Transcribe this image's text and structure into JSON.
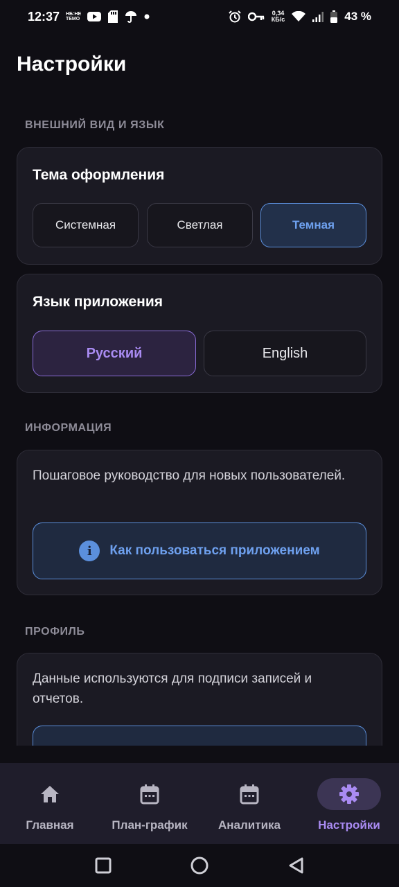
{
  "status_bar": {
    "time": "12:37",
    "mini_icon_text": "НБ:НЕ ТЕМО",
    "net_speed_value": "0,34",
    "net_speed_unit": "КБ/с",
    "battery": "43 %"
  },
  "page": {
    "title": "Настройки"
  },
  "appearance": {
    "section_label": "ВНЕШНИЙ ВИД И ЯЗЫК",
    "theme": {
      "title": "Тема оформления",
      "options": [
        "Системная",
        "Светлая",
        "Темная"
      ],
      "selected": "Темная"
    },
    "language": {
      "title": "Язык приложения",
      "options": [
        "Русский",
        "English"
      ],
      "selected": "Русский"
    }
  },
  "info": {
    "section_label": "ИНФОРМАЦИЯ",
    "description": "Пошаговое руководство для новых пользователей.",
    "help_button": "Как пользоваться приложением"
  },
  "profile": {
    "section_label": "ПРОФИЛЬ",
    "description": "Данные используются для подписи записей и отчетов."
  },
  "bottom_nav": {
    "items": [
      {
        "label": "Главная",
        "icon": "home-icon"
      },
      {
        "label": "План-график",
        "icon": "calendar-icon"
      },
      {
        "label": "Аналитика",
        "icon": "calendar-icon"
      },
      {
        "label": "Настройки",
        "icon": "gear-icon"
      }
    ],
    "active": "Настройки"
  },
  "colors": {
    "background": "#0f0e14",
    "card": "#1b1a23",
    "accent_blue": "#6ea0ee",
    "accent_purple": "#a98bf2"
  }
}
